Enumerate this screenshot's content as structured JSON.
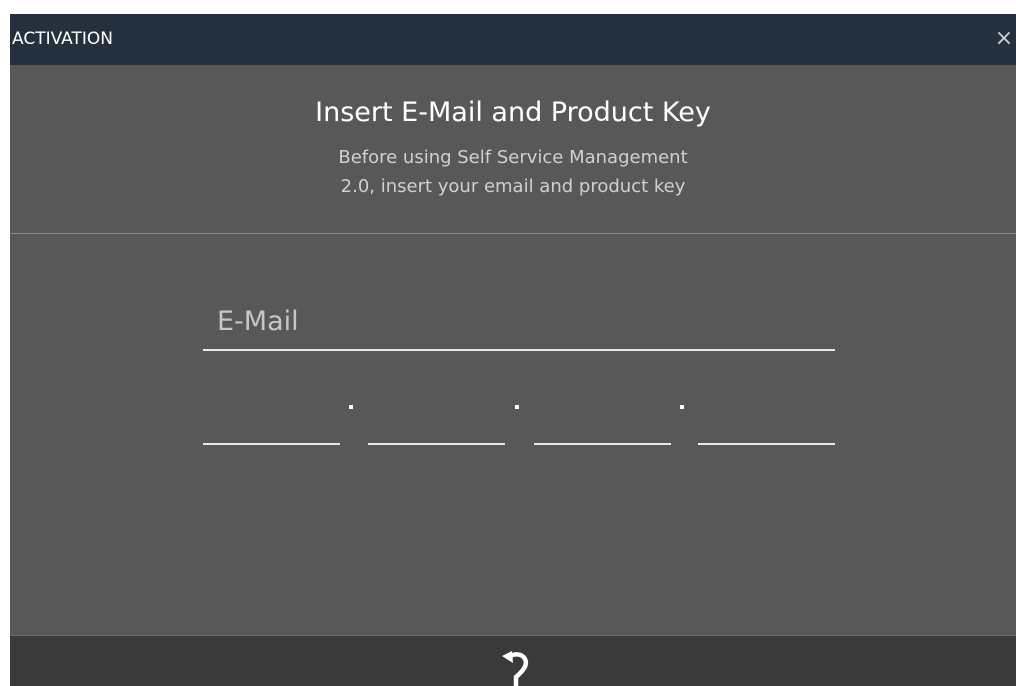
{
  "window": {
    "title": "ACTIVATION",
    "close_glyph": "×"
  },
  "header": {
    "title": "Insert E-Mail and Product Key",
    "subtitle_line1": "Before using Self Service Management",
    "subtitle_line2": "2.0, insert your email and product key"
  },
  "form": {
    "email": {
      "placeholder": "E-Mail",
      "value": ""
    },
    "product_key": {
      "segments": [
        "",
        "",
        "",
        ""
      ],
      "separator": "·"
    }
  },
  "footer": {
    "undo_icon": "undo-icon"
  },
  "colors": {
    "titlebar": "#25303e",
    "panel": "#585858",
    "footer": "#3a3a3a",
    "text": "#ffffff"
  }
}
